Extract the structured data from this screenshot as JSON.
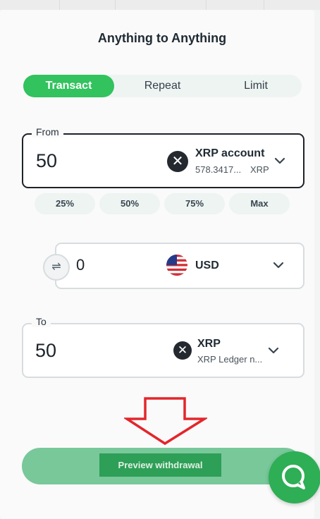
{
  "header": {
    "title": "Anything to Anything"
  },
  "tabs": [
    {
      "label": "Transact",
      "active": true
    },
    {
      "label": "Repeat",
      "active": false
    },
    {
      "label": "Limit",
      "active": false
    }
  ],
  "from": {
    "legend": "From",
    "amount": "50",
    "token_name": "XRP account",
    "token_balance": "578.3417...",
    "token_symbol": "XRP",
    "token_icon": "xrp-icon"
  },
  "percent_buttons": [
    "25%",
    "50%",
    "75%",
    "Max"
  ],
  "middle": {
    "amount": "0",
    "currency": "USD",
    "currency_icon": "us-flag-icon",
    "swap_icon": "swap-icon"
  },
  "to": {
    "legend": "To",
    "amount": "50",
    "token_name": "XRP",
    "token_network": "XRP Ledger n...",
    "token_icon": "xrp-icon"
  },
  "actions": {
    "preview_label": "Preview withdrawal"
  },
  "colors": {
    "accent": "#32c25e",
    "preview_button": "#78c89a",
    "annotation_arrow": "#e3262b",
    "chat_button": "#2eae55"
  }
}
